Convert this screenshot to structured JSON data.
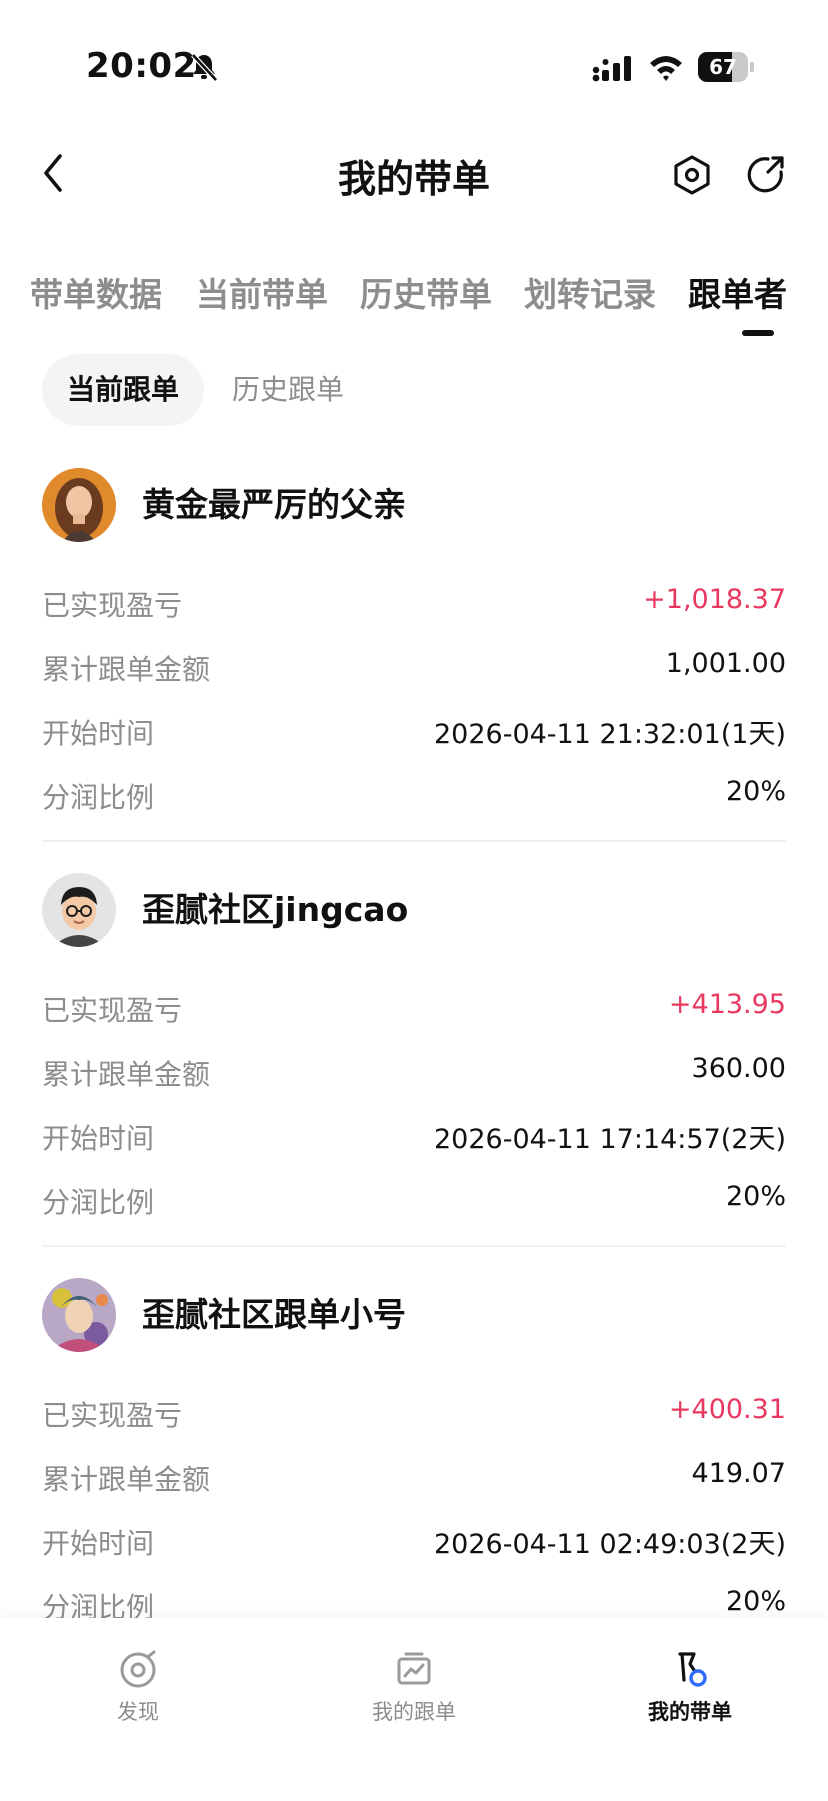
{
  "status_bar": {
    "time": "20:02",
    "battery": "67",
    "battery_level": 0.67
  },
  "nav": {
    "title": "我的带单"
  },
  "tabs": [
    {
      "label": "带单数据"
    },
    {
      "label": "当前带单"
    },
    {
      "label": "历史带单"
    },
    {
      "label": "划转记录"
    },
    {
      "label": "跟单者"
    }
  ],
  "sub_tabs": [
    {
      "label": "当前跟单"
    },
    {
      "label": "历史跟单"
    }
  ],
  "row_labels": {
    "pnl": "已实现盈亏",
    "amount": "累计跟单金额",
    "start": "开始时间",
    "share": "分润比例"
  },
  "followers": [
    {
      "name": "黄金最严厉的父亲",
      "pnl": "+1,018.37",
      "amount": "1,001.00",
      "start": "2026-04-11 21:32:01(1天)",
      "share": "20%"
    },
    {
      "name": "歪腻社区jingcao",
      "pnl": "+413.95",
      "amount": "360.00",
      "start": "2026-04-11 17:14:57(2天)",
      "share": "20%"
    },
    {
      "name": "歪腻社区跟单小号",
      "pnl": "+400.31",
      "amount": "419.07",
      "start": "2026-04-11 02:49:03(2天)",
      "share": "20%"
    }
  ],
  "bottom_nav": [
    {
      "label": "发现",
      "icon": "discover-icon"
    },
    {
      "label": "我的跟单",
      "icon": "chart-icon"
    },
    {
      "label": "我的带单",
      "icon": "lead-trade-icon"
    }
  ],
  "colors": {
    "profit": "#e8385f",
    "text_primary": "#111111",
    "text_secondary": "#8d8d8d",
    "accent_blue": "#2f6bff"
  }
}
